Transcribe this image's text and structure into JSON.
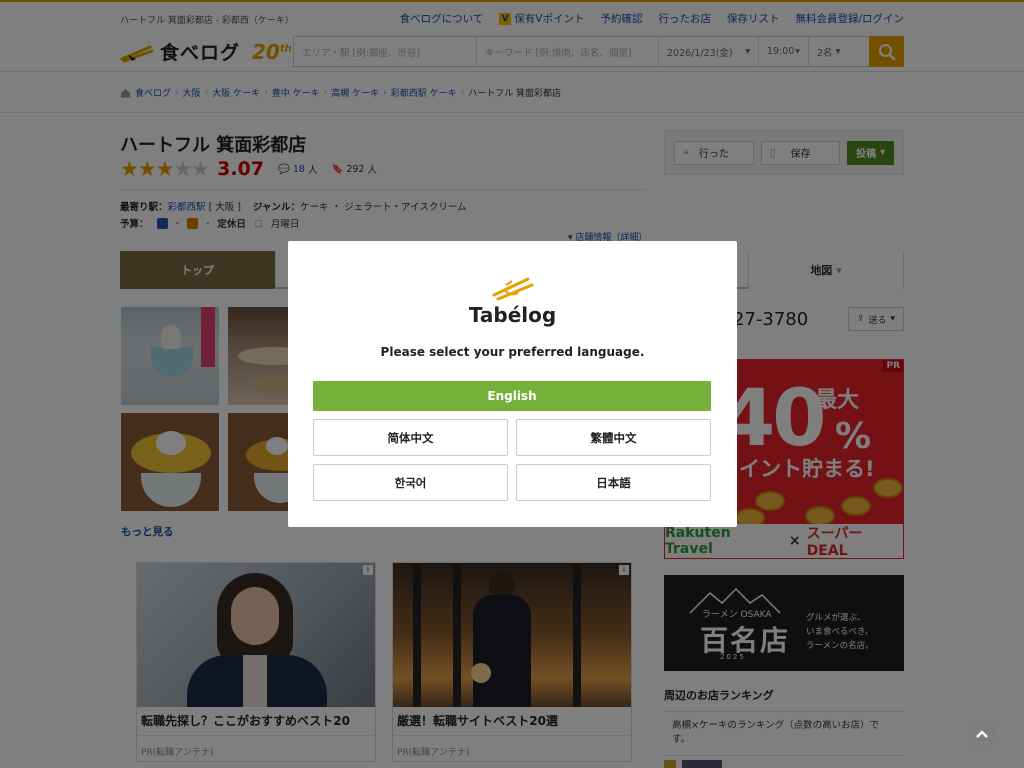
{
  "header": {
    "subtitle": "ハートフル 箕面彩都店 - 彩都西（ケーキ）",
    "links": [
      "食べログについて",
      "保有Vポイント",
      "予約確認",
      "行ったお店",
      "保存リスト",
      "無料会員登録/ログイン"
    ],
    "vpoint_badge": "V",
    "logo_text": "食べログ",
    "logo_anniv": "20",
    "logo_anniv_suffix": "th"
  },
  "search": {
    "area_placeholder": "エリア・駅 [例:銀座、渋谷]",
    "keyword_placeholder": "キーワード [例:焼肉、店名、個室]",
    "date": "2026/1/23(金)",
    "time": "19:00",
    "people": "2名",
    "button_icon": "search-icon"
  },
  "breadcrumb": [
    "食べログ",
    "大阪",
    "大阪 ケーキ",
    "豊中 ケーキ",
    "高槻 ケーキ",
    "彩都西駅 ケーキ",
    "ハートフル 箕面彩都店"
  ],
  "shop": {
    "name": "ハートフル 箕面彩都店",
    "stars_on": "★★★",
    "stars_off": "★★",
    "score": "3.07",
    "reviews": "18",
    "reviews_unit": "人",
    "saves": "292",
    "saves_unit": "人",
    "station_label": "最寄り駅：",
    "station": "彩都西駅",
    "station_extra": "[ 大阪 ]",
    "genre_label": "ジャンル：",
    "genre": "ケーキ ・ ジェラート・アイスクリーム",
    "budget_label": "予算：",
    "budget_dinner": "-",
    "budget_lunch": "-",
    "holiday_label": "定休日",
    "holiday": "月曜日",
    "details_link": "店舗情報（詳細）"
  },
  "actions": {
    "visited": "行った",
    "save": "保存",
    "post": "投稿"
  },
  "tabs": {
    "top": "トップ",
    "map": "地図"
  },
  "photos_more": "もっと見る",
  "phone": "27-3780",
  "send_label": "送る",
  "ad1": {
    "pr": "PR",
    "max": "最大",
    "big": "40",
    "pct": "%",
    "save_text": "イント貯まる!",
    "brand": "Rakuten Travel",
    "times": "×",
    "deal": "スーパーDEAL"
  },
  "ad2": {
    "small": "ラーメン OSAKA",
    "title": "百名店",
    "year": "2025",
    "copy1": "グルメが選ぶ、",
    "copy2": "いま食べるべき、",
    "copy3": "ラーメンの名店。"
  },
  "ranking": {
    "heading": "周辺のお店ランキング",
    "text": "高槻×ケーキのランキング（点数の高いお店）です。"
  },
  "cards": [
    {
      "title": "転職先探し？ここがおすすめベスト20",
      "source": "PR(転職アンテナ)"
    },
    {
      "title": "厳選！転職サイトベスト20選",
      "source": "PR(転職アンテナ)"
    }
  ],
  "modal": {
    "brand": "Tabélog",
    "prompt": "Please select your preferred language.",
    "english": "English",
    "simplified": "简体中文",
    "traditional": "繁體中文",
    "korean": "한국어",
    "japanese": "日本語"
  },
  "colors": {
    "accent": "#e6a000",
    "english_button": "#75b03a",
    "score": "#cc0000",
    "link": "#1a4bae"
  }
}
